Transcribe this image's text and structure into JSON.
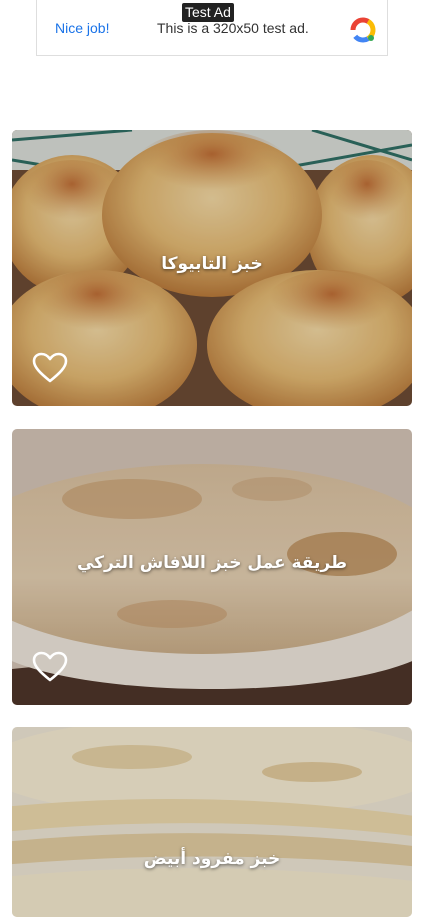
{
  "ad": {
    "tag": "Test Ad",
    "nice_job": "Nice job!",
    "text": "This is a 320x50 test ad."
  },
  "recipes": [
    {
      "title": "خبز التابيوكا",
      "favorite_icon": "heart-outline-icon"
    },
    {
      "title": "طريقة عمل خبز اللافاش التركي",
      "favorite_icon": "heart-outline-icon"
    },
    {
      "title": "خبز مفرود أبيض"
    }
  ]
}
